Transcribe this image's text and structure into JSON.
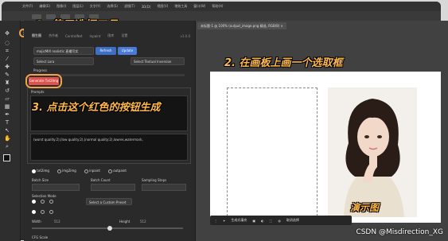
{
  "menubar": {
    "items": [
      "文件(F)",
      "编辑(E)",
      "图像(I)",
      "图层(L)",
      "文字(Y)",
      "选择(S)",
      "滤镜(T)",
      "3D(D)",
      "视图(V)",
      "增效工具",
      "窗口(W)",
      "帮助(H)"
    ]
  },
  "document_tab": {
    "label": "未标题-1 @ 100% (output_image.png 精选, RGB/8) ×"
  },
  "panel": {
    "tabs": [
      "图生图",
      "合作者",
      "ControlNet",
      "Inpaint",
      "图库",
      "设置"
    ],
    "version": "v1.0.0",
    "model_select": "majicMIX realistic 麦橘写实",
    "lora_select": "Select Lora",
    "refresh_label": "Refresh",
    "update_label": "Update",
    "textual_inversion_select": "Select Textual Inversion",
    "progress_label": "Progress",
    "generate_label": "Generate Txt2Img",
    "prompts_label": "Prompts",
    "negative_prompt_text": "(worst quality:2),(low quality:2),(normal quality:2),lowres,watermark,",
    "modes": [
      "txt2img",
      "img2img",
      "inpaint",
      "outpaint"
    ],
    "batch_size_label": "Batch Size",
    "batch_count_label": "Batch Count",
    "sampling_steps_label": "Sampling Steps",
    "selection_mode_label": "Selection Mode",
    "preset_select": "Select a Custom Preset",
    "width_label": "Width",
    "height_label": "Height",
    "cfg_label": "CFG Scale",
    "width_value": "512",
    "height_value": "512"
  },
  "annotations": {
    "step1": "1. 使用选框工具",
    "step2": "2. 在画板上画一个选取框",
    "step3": "3. 点击这个红色的按钮生成",
    "photo_caption": "演示图"
  },
  "context_bar": {
    "label": "生成式填充",
    "right_label": "取消选择"
  },
  "watermark": "CSDN @Misdirection_XG",
  "colors": {
    "generate_button": "#e0524d",
    "highlight_ring": "#f0a14a",
    "annotation": "#ffb84a",
    "blue_button": "#4a7bd8"
  }
}
